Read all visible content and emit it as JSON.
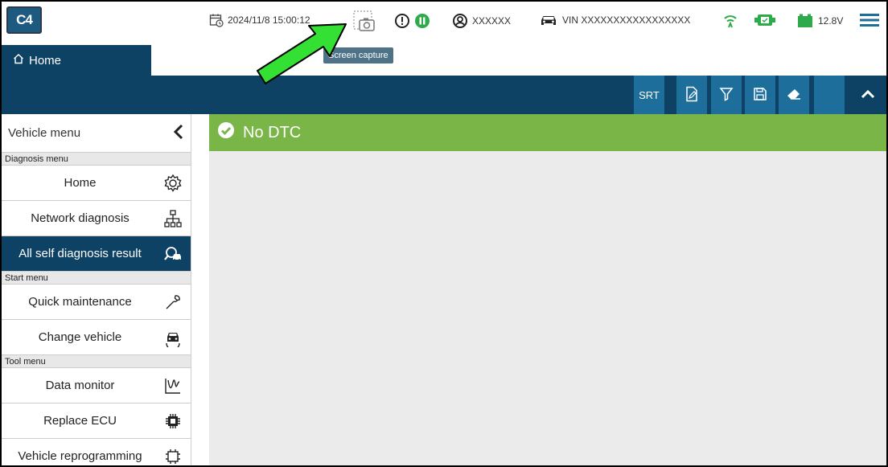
{
  "app": {
    "logo_text": "C4"
  },
  "status_bar": {
    "datetime": "2024/11/8 15:00:12",
    "user": "XXXXXX",
    "vin": "VIN XXXXXXXXXXXXXXXXX",
    "voltage": "12.8V"
  },
  "tooltip": {
    "screen_capture": "Screen capture"
  },
  "tabs": {
    "home_label": "Home"
  },
  "toolbar": {
    "srt_label": "SRT"
  },
  "sidebar": {
    "title": "Vehicle menu",
    "sections": {
      "diagnosis": "Diagnosis menu",
      "start": "Start menu",
      "tool": "Tool menu"
    },
    "items": {
      "home": "Home",
      "network": "Network diagnosis",
      "all_self": "All self diagnosis result",
      "quick": "Quick maintenance",
      "change": "Change vehicle",
      "data_monitor": "Data monitor",
      "replace_ecu": "Replace ECU",
      "reprogramming": "Vehicle reprogramming"
    }
  },
  "main": {
    "dtc_status": "No DTC"
  },
  "colors": {
    "navy": "#0d4265",
    "toolbar_button": "#1d6e9a",
    "dtc_green": "#7ab547",
    "status_green": "#2faa4a",
    "annotation_arrow": "#33e033"
  }
}
